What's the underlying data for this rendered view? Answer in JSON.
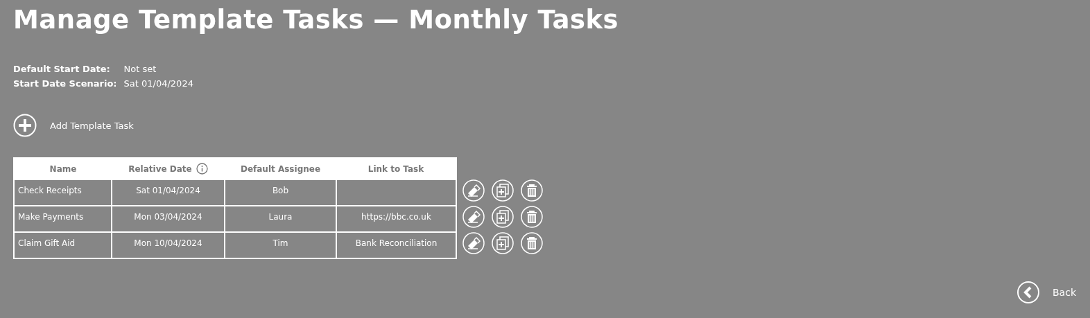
{
  "title": "Manage Template Tasks — Monthly Tasks",
  "details": [
    {
      "label": "Default Start Date:",
      "value": "Not set"
    },
    {
      "label": "Start Date Scenario:",
      "value": "Sat 01/04/2024"
    }
  ],
  "add_button": {
    "label": "Add Template Task"
  },
  "table": {
    "columns": [
      {
        "label": "Name",
        "info": false
      },
      {
        "label": "Relative Date",
        "info": true
      },
      {
        "label": "Default Assignee",
        "info": false
      },
      {
        "label": "Link to Task",
        "info": false
      }
    ],
    "rows": [
      {
        "cells": [
          "Check Receipts",
          "Sat 01/04/2024",
          "Bob",
          ""
        ]
      },
      {
        "cells": [
          "Make Payments",
          "Mon 03/04/2024",
          "Laura",
          "https://bbc.co.uk"
        ]
      },
      {
        "cells": [
          "Claim Gift Aid",
          "Mon 10/04/2024",
          "Tim",
          "Bank Reconciliation"
        ]
      }
    ]
  },
  "back_button": {
    "label": "Back"
  }
}
